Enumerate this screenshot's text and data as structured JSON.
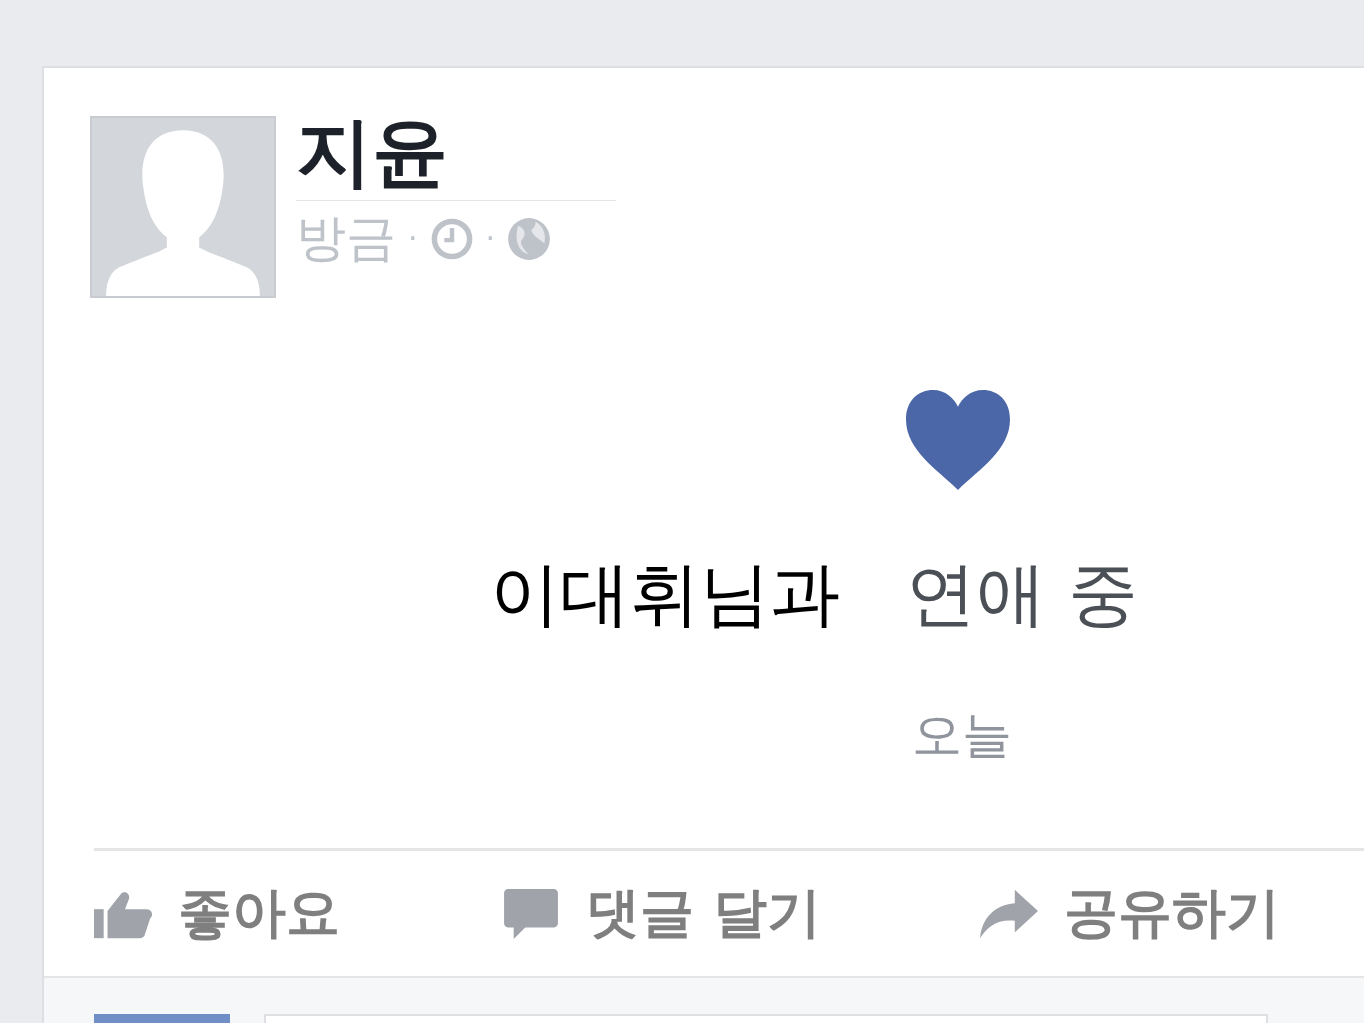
{
  "post": {
    "author": "지윤",
    "time": "방금",
    "separator": "·",
    "life_event": {
      "partner": "이대휘님과",
      "status": "연애 중",
      "date": "오늘"
    },
    "actions": [
      {
        "kind": "like",
        "label": "좋아요"
      },
      {
        "kind": "comment",
        "label": "댓글 달기"
      },
      {
        "kind": "share",
        "label": "공유하기"
      }
    ]
  }
}
